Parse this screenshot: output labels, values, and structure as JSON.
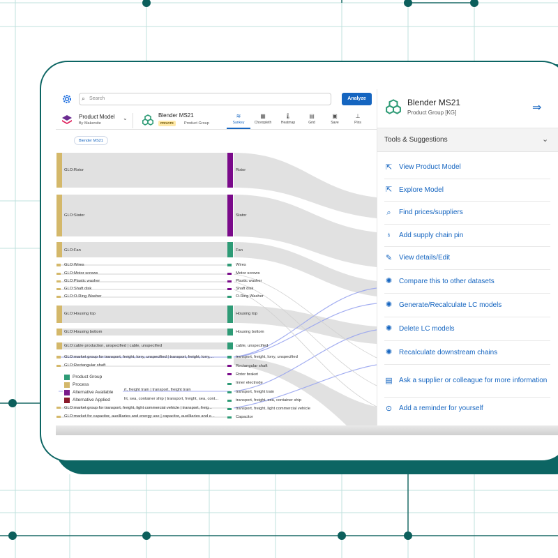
{
  "search": {
    "placeholder": "Search"
  },
  "toolbar": {
    "analyze_label": "Analyze",
    "product_model": {
      "title": "Product Model",
      "subtitle": "By Makersite"
    },
    "blender": {
      "title": "Blender MS21",
      "badge": "PRIVATE",
      "type": "Product Group"
    },
    "tools": [
      {
        "label": "Sankey",
        "icon": "sankey-icon",
        "active": true
      },
      {
        "label": "Choropleth",
        "icon": "choropleth-icon",
        "active": false
      },
      {
        "label": "Heatmap",
        "icon": "heatmap-icon",
        "active": false
      },
      {
        "label": "Grid",
        "icon": "grid-icon",
        "active": false
      },
      {
        "label": "Save",
        "icon": "save-icon",
        "active": false
      },
      {
        "label": "Pins",
        "icon": "pin-icon",
        "active": false
      }
    ]
  },
  "chip": {
    "label": "Blender MS21"
  },
  "sankey": {
    "left_nodes": [
      "GLO:Rotor",
      "GLO:Stator",
      "GLO:Fan",
      "GLO:Wires",
      "GLO:Motor screws",
      "GLO:Plastic washer",
      "GLO:Shaft disk",
      "GLO:O-Ring Washer",
      "GLO:Housing top",
      "GLO:Housing bottom",
      "GLO:cable production, unspecified | cable, unspecified",
      "GLO:market group for transport, freight, lorry, unspecified | transport, freight, lorry,...",
      "GLO:Rectangular shaft",
      "GLO:market group for transport, freight train | transport, freight train",
      "GLO:market group for transport, freight, sea, container ship | transport, freight, sea, cont...",
      "GLO:market group for transport, freight, light commercial vehicle | transport, freig...",
      "GLO:market for capacitor, auxilliaries and energy use | capacitor, auxilliaries and e..."
    ],
    "legend_occluded_left": [
      "rt, freight train | transport, freight train",
      "ht, sea, container ship | transport, freight, sea, cont..."
    ],
    "right_nodes": [
      "Rotor",
      "Stator",
      "Fan",
      "Wires",
      "Motor screws",
      "Plastic washer",
      "Shaft disk",
      "O-Ring Washer",
      "Housing top",
      "Housing bottom",
      "cable, unspecified",
      "transport, freight, lorry, unspecified",
      "Rectangular shaft",
      "Rotor braket",
      "Inner electrode",
      "transport, freight train",
      "transport, freight, sea, container ship",
      "transport, freight, light commercial vehicle",
      "Capacitor"
    ],
    "legend": [
      {
        "label": "Product Group",
        "color": "#2e9b76"
      },
      {
        "label": "Process",
        "color": "#d4b86a"
      },
      {
        "label": "Alternative Available",
        "color": "#7a1a8a"
      },
      {
        "label": "Alternative Applied",
        "color": "#8a1a2a"
      }
    ]
  },
  "panel": {
    "title": "Blender MS21",
    "subtitle": "Product Group [KG]",
    "tools_title": "Tools & Suggestions",
    "actions": [
      {
        "label": "View Product Model",
        "icon": "view-model-icon"
      },
      {
        "label": "Explore Model",
        "icon": "explore-icon"
      },
      {
        "label": "Find prices/suppliers",
        "icon": "price-search-icon"
      },
      {
        "label": "Add supply chain pin",
        "icon": "pin-icon"
      },
      {
        "label": "View details/Edit",
        "icon": "edit-icon"
      },
      {
        "label": "Compare this to other datasets",
        "icon": "lightbulb-icon"
      },
      {
        "label": "Generate/Recalculate LC models",
        "icon": "lightbulb-icon"
      },
      {
        "label": "Delete LC models",
        "icon": "lightbulb-icon"
      },
      {
        "label": "Recalculate downstream chains",
        "icon": "lightbulb-icon"
      },
      {
        "label": "Ask a supplier or colleague for more information",
        "icon": "message-icon"
      },
      {
        "label": "Add a reminder for yourself",
        "icon": "reminder-icon"
      }
    ]
  }
}
